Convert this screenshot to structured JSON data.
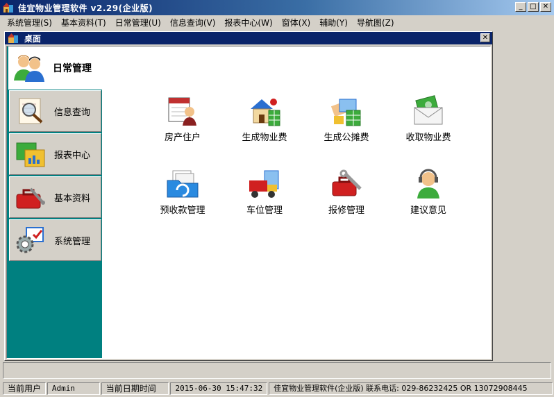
{
  "window": {
    "title": "佳宜物业管理软件 v2.29(企业版)",
    "buttons": {
      "minimize": "_",
      "maximize": "□",
      "close": "✕"
    }
  },
  "menu": [
    {
      "label": "系统管理(S)"
    },
    {
      "label": "基本资料(T)"
    },
    {
      "label": "日常管理(U)"
    },
    {
      "label": "信息查询(V)"
    },
    {
      "label": "报表中心(W)"
    },
    {
      "label": "窗体(X)"
    },
    {
      "label": "辅助(Y)"
    },
    {
      "label": "导航图(Z)"
    }
  ],
  "desktop": {
    "title": "桌面",
    "close": "✕",
    "nav": [
      {
        "label": "日常管理",
        "icon": "users-icon",
        "active": true
      },
      {
        "label": "信息查询",
        "icon": "magnifier-document-icon"
      },
      {
        "label": "报表中心",
        "icon": "report-chart-icon"
      },
      {
        "label": "基本资料",
        "icon": "toolbox-icon"
      },
      {
        "label": "系统管理",
        "icon": "settings-gear-icon"
      }
    ],
    "tiles": [
      {
        "label": "房产住户",
        "icon": "resident-calendar-icon"
      },
      {
        "label": "生成物业费",
        "icon": "house-fee-icon"
      },
      {
        "label": "生成公摊费",
        "icon": "shared-fee-icon"
      },
      {
        "label": "收取物业费",
        "icon": "money-envelope-icon"
      },
      {
        "label": "预收款管理",
        "icon": "folder-prepay-icon"
      },
      {
        "label": "车位管理",
        "icon": "truck-parking-icon"
      },
      {
        "label": "报修管理",
        "icon": "repair-toolbox-icon"
      },
      {
        "label": "建议意见",
        "icon": "support-headset-icon"
      }
    ]
  },
  "status": {
    "user_label": "当前用户",
    "user_value": "Admin",
    "datetime_label": "当前日期时间",
    "datetime_value": "2015-06-30 15:47:32",
    "info": "佳宜物业管理软件(企业版) 联系电话: 029-86232425 OR 13072908445"
  },
  "colors": {
    "title_bar": "#0a246a",
    "nav_background": "#008080",
    "content_background": "#ffffff",
    "window_face": "#d4d0c8"
  }
}
